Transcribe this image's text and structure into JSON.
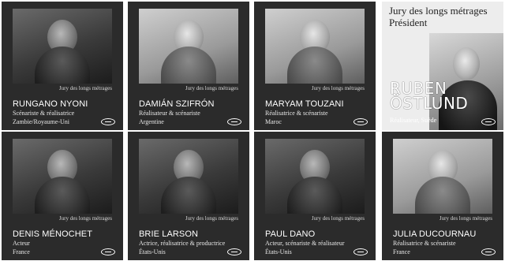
{
  "jury_label": "Jury des longs métrages",
  "president": {
    "jury_label": "Jury des longs métrages",
    "title": "Président",
    "name_line1": "RUBEN",
    "name_line2": "ÖSTLUND",
    "role": "Réalisateur, Suède"
  },
  "members": [
    {
      "name": "RUNGANO NYONI",
      "role": "Scénariste & réalisatrice",
      "country": "Zambie/Royaume-Uni"
    },
    {
      "name": "DAMIÁN SZIFRÓN",
      "role": "Réalisateur & scénariste",
      "country": "Argentine"
    },
    {
      "name": "MARYAM TOUZANI",
      "role": "Réalisatrice & scénariste",
      "country": "Maroc"
    },
    {
      "name": "DENIS MÉNOCHET",
      "role": "Acteur",
      "country": "France"
    },
    {
      "name": "BRIE LARSON",
      "role": "Actrice, réalisatrice & productrice",
      "country": "États-Unis"
    },
    {
      "name": "PAUL DANO",
      "role": "Acteur, scénariste & réalisateur",
      "country": "États-Unis"
    },
    {
      "name": "JULIA DUCOURNAU",
      "role": "Réalisatrice & scénariste",
      "country": "France"
    }
  ],
  "icons": {
    "logo": "festival-logo-icon",
    "portrait": "portrait-photo"
  },
  "colors": {
    "card_bg": "#2b2b2b",
    "president_bg": "#ededed",
    "text": "#ffffff"
  }
}
